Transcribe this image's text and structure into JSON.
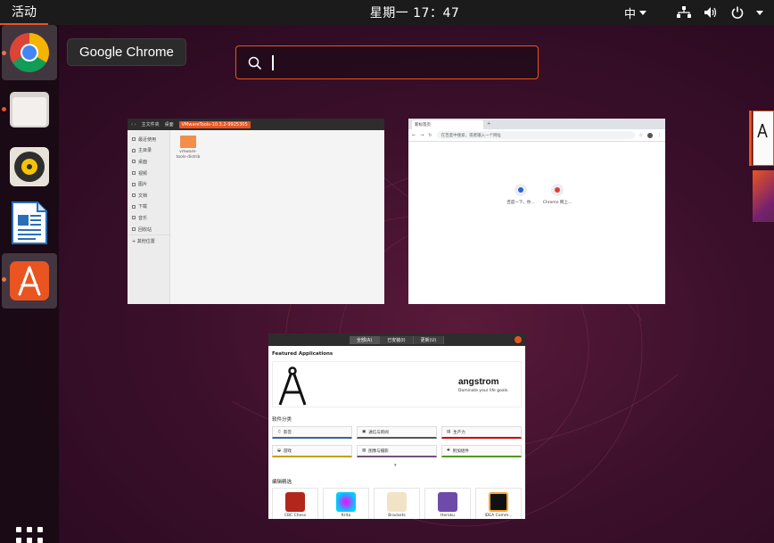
{
  "topbar": {
    "activities": "活动",
    "clock": "星期一 17：47",
    "input_method": "中"
  },
  "tooltip": {
    "text": "Google Chrome"
  },
  "search": {
    "value": "",
    "placeholder": ""
  },
  "dock": {
    "apps": [
      {
        "name": "Google Chrome",
        "icon": "chrome-icon",
        "running": true,
        "active": true
      },
      {
        "name": "Files",
        "icon": "files-icon",
        "running": true,
        "active": false
      },
      {
        "name": "Rhythmbox",
        "icon": "rhythmbox-icon",
        "running": false,
        "active": false
      },
      {
        "name": "LibreOffice Writer",
        "icon": "writer-icon",
        "running": false,
        "active": false
      },
      {
        "name": "Ubuntu Software",
        "icon": "software-icon",
        "running": true,
        "active": true
      }
    ]
  },
  "windows": {
    "files": {
      "home_label": "主文件夹",
      "desktop_label": "桌面",
      "path_label": "VMwareTools-10.3.2-9925305",
      "sidebar": [
        "最近使用",
        "主目录",
        "桌面",
        "视频",
        "图片",
        "文档",
        "下载",
        "音乐",
        "回收站",
        "+ 其他位置"
      ],
      "folder_name": "vmware-tools-distrib"
    },
    "chrome": {
      "tab_title": "新标签页",
      "omnibox": "在百度中搜索，或者输入一个网址",
      "shortcuts": [
        "百度一下，你...",
        "Chrome 网上..."
      ]
    },
    "software": {
      "tabs": [
        "全部(A)",
        "已安装(I)",
        "更新(U)"
      ],
      "featured_title": "Featured Applications",
      "banner_name": "angstrom",
      "banner_tagline": "Dominate your life goals.",
      "categories_title": "软件分类",
      "categories": [
        {
          "label": "影音",
          "color": "#3465a4"
        },
        {
          "label": "通信与新闻",
          "color": "#555753"
        },
        {
          "label": "生产力",
          "color": "#cc0000"
        },
        {
          "label": "游戏",
          "color": "#c4a000"
        },
        {
          "label": "图像与摄影",
          "color": "#75507b"
        },
        {
          "label": "附加组件",
          "color": "#4e9a06"
        }
      ],
      "picks_title": "编辑精选",
      "picks": [
        "CBC Chess",
        "Krita",
        "Brackets",
        "Heroku",
        "IDEA Comm..."
      ]
    }
  },
  "colors": {
    "accent": "#e95420",
    "panel": "#1b1b1b"
  }
}
